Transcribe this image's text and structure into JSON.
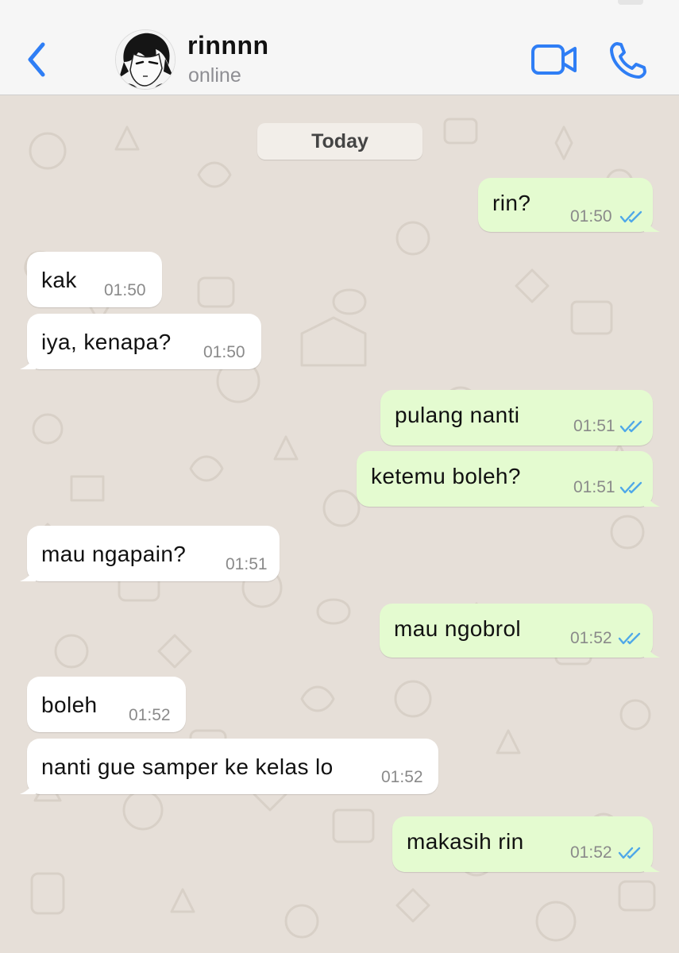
{
  "header": {
    "contact_name": "rinnnn",
    "status": "online",
    "icons": {
      "back": "chevron-left-icon",
      "video": "video-camera-icon",
      "call": "phone-icon"
    },
    "accent_color": "#2f7ef5"
  },
  "chat": {
    "date_label": "Today",
    "messages": [
      {
        "direction": "out",
        "text": "rin?",
        "time": "01:50",
        "read": true
      },
      {
        "direction": "in",
        "text": "kak",
        "time": "01:50"
      },
      {
        "direction": "in",
        "text": "iya, kenapa?",
        "time": "01:50"
      },
      {
        "direction": "out",
        "text": "pulang nanti",
        "time": "01:51",
        "read": true
      },
      {
        "direction": "out",
        "text": "ketemu boleh?",
        "time": "01:51",
        "read": true
      },
      {
        "direction": "in",
        "text": "mau ngapain?",
        "time": "01:51"
      },
      {
        "direction": "out",
        "text": "mau ngobrol",
        "time": "01:52",
        "read": true
      },
      {
        "direction": "in",
        "text": "boleh",
        "time": "01:52"
      },
      {
        "direction": "in",
        "text": "nanti gue samper ke kelas lo",
        "time": "01:52"
      },
      {
        "direction": "out",
        "text": "makasih rin",
        "time": "01:52",
        "read": true
      }
    ]
  },
  "colors": {
    "wallpaper": "#e6dfd8",
    "incoming_bubble": "#ffffff",
    "outgoing_bubble": "#e4fbd0",
    "read_ticks": "#4fa8e8"
  }
}
